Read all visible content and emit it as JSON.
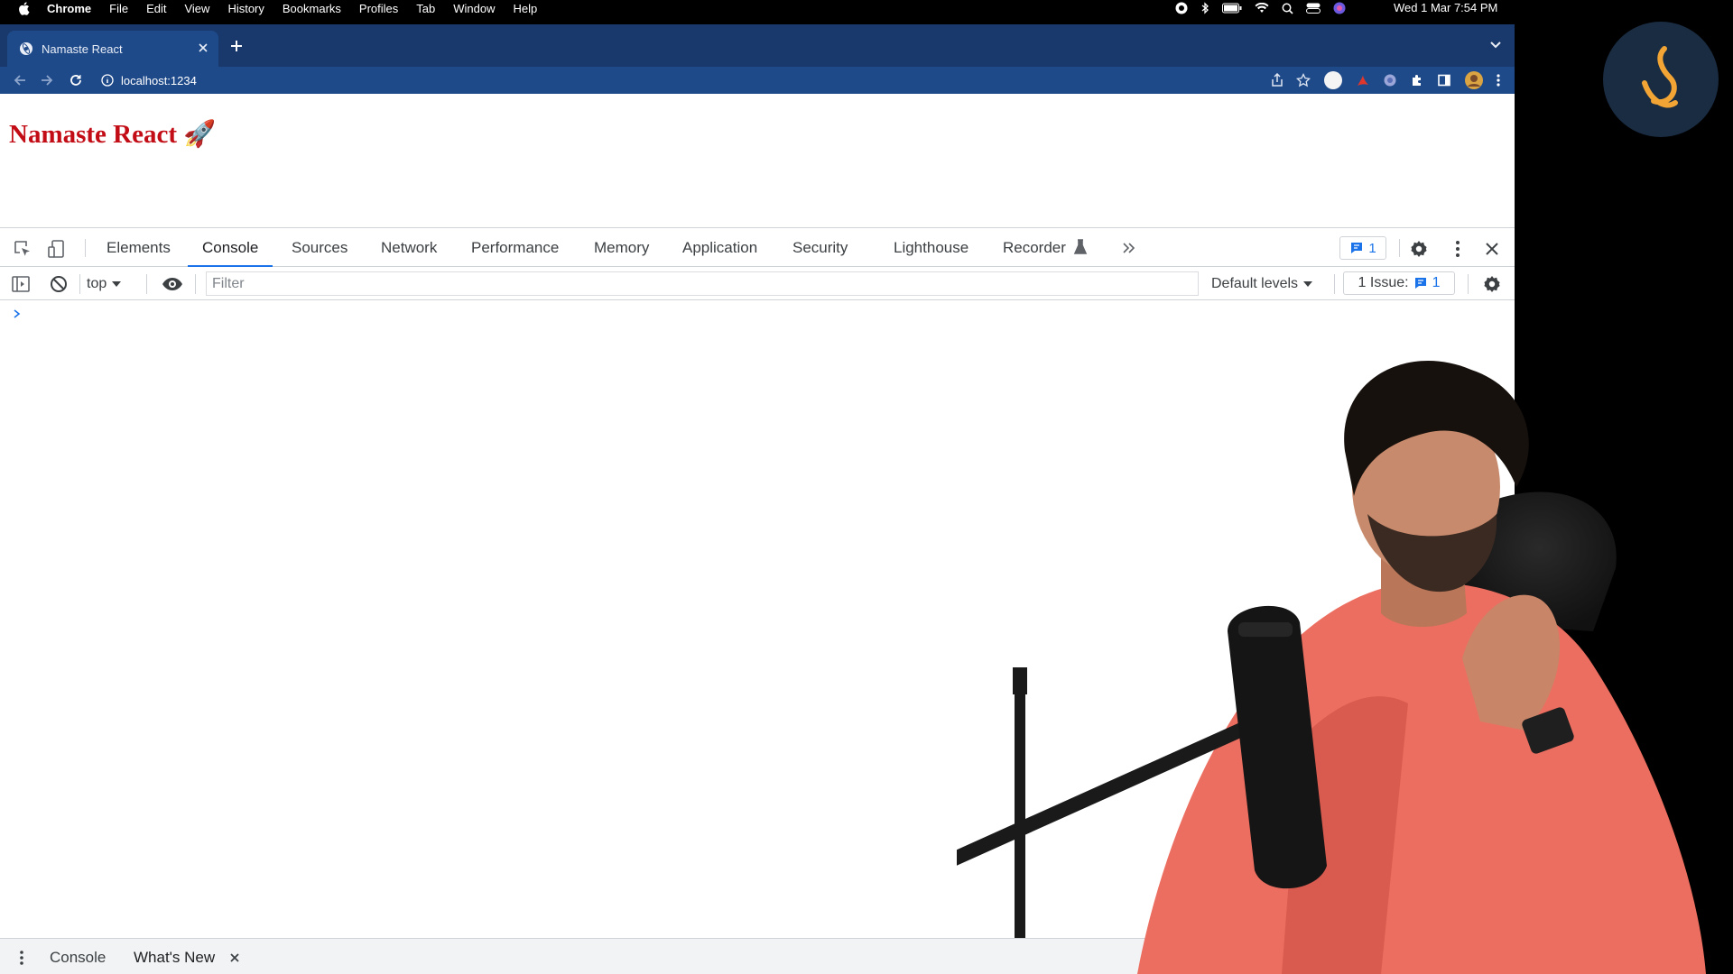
{
  "menubar": {
    "app": "Chrome",
    "items": [
      "File",
      "Edit",
      "View",
      "History",
      "Bookmarks",
      "Profiles",
      "Tab",
      "Window",
      "Help"
    ],
    "clock": "Wed 1 Mar  7:54 PM"
  },
  "browser": {
    "tab_title": "Namaste React",
    "url": "localhost:1234"
  },
  "page": {
    "heading": "Namaste React 🚀"
  },
  "devtools": {
    "tabs": [
      "Elements",
      "Console",
      "Sources",
      "Network",
      "Performance",
      "Memory",
      "Application",
      "Security",
      "Lighthouse",
      "Recorder"
    ],
    "active_tab": "Console",
    "messages_count": "1",
    "context": "top",
    "filter_placeholder": "Filter",
    "levels": "Default levels",
    "issues_label": "1 Issue:",
    "issues_count": "1",
    "drawer_tabs": [
      "Console",
      "What's New"
    ]
  },
  "colors": {
    "tabstrip": "#19386b",
    "toolbar": "#1f4a8a",
    "heading": "#c30d16",
    "accent": "#1a73e8"
  }
}
